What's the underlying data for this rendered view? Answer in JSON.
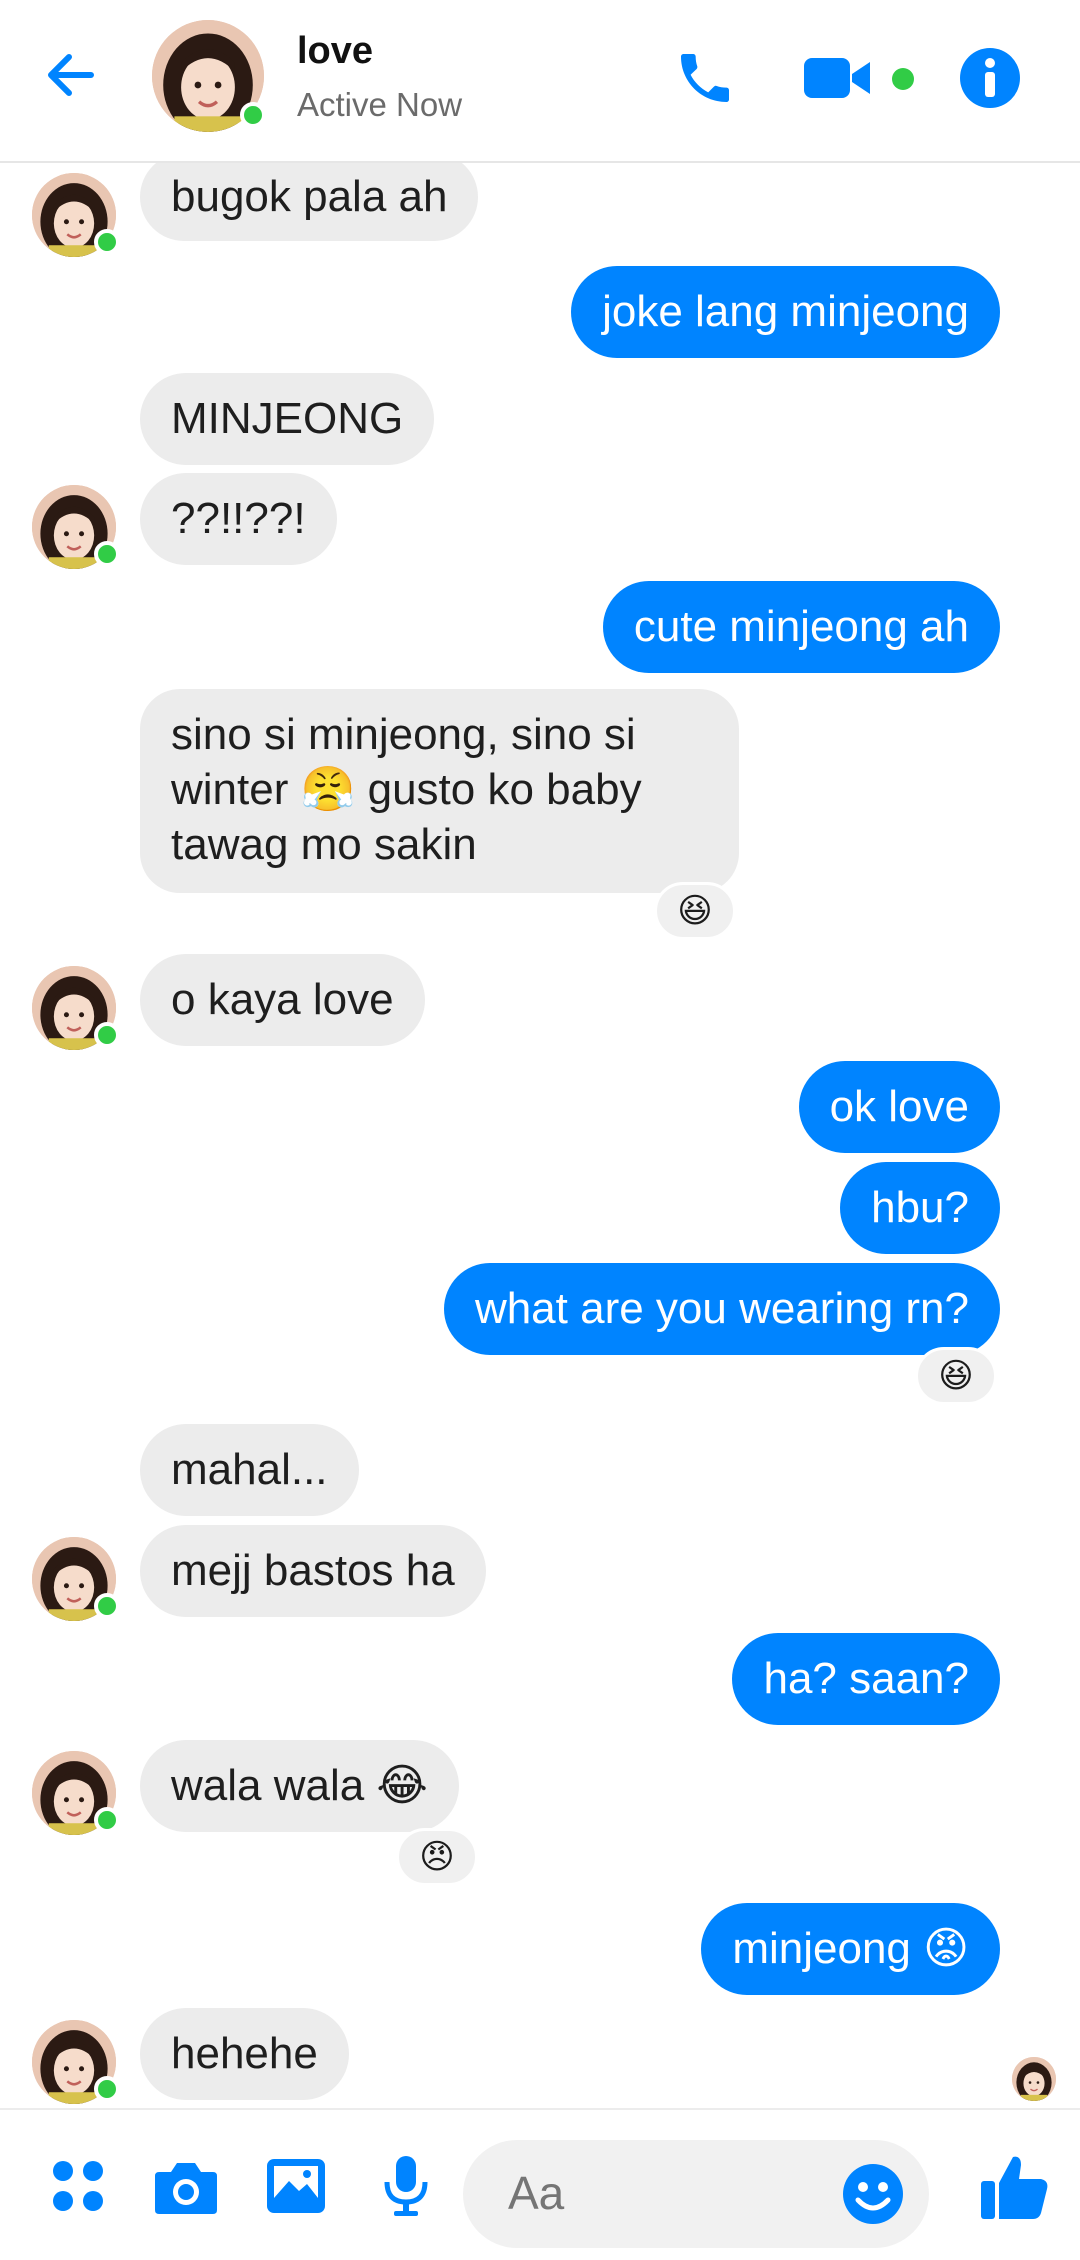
{
  "header": {
    "name": "love",
    "status": "Active Now",
    "accent_color": "#0084ff",
    "online_color": "#31cc46"
  },
  "messages": [
    {
      "from": "them",
      "text": "bugok pala ah"
    },
    {
      "from": "me",
      "text": "joke lang minjeong"
    },
    {
      "from": "them",
      "text": "MINJEONG"
    },
    {
      "from": "them",
      "text": "??!!??!"
    },
    {
      "from": "me",
      "text": "cute minjeong ah"
    },
    {
      "from": "them",
      "text": "sino si minjeong, sino si winter 😤 gusto ko baby tawag mo sakin",
      "reaction": "😆"
    },
    {
      "from": "them",
      "text": "o kaya love"
    },
    {
      "from": "me",
      "text": "ok love"
    },
    {
      "from": "me",
      "text": "hbu?"
    },
    {
      "from": "me",
      "text": "what are you wearing rn?",
      "reaction": "😆"
    },
    {
      "from": "them",
      "text": "mahal..."
    },
    {
      "from": "them",
      "text": "mejj bastos ha"
    },
    {
      "from": "me",
      "text": "ha? saan?"
    },
    {
      "from": "them",
      "text": "wala wala 😂",
      "reaction": "😠"
    },
    {
      "from": "me",
      "text": "minjeong 😡"
    },
    {
      "from": "them",
      "text": "hehehe"
    }
  ],
  "composer": {
    "placeholder": "Aa",
    "icons": [
      "menu-icon",
      "camera-icon",
      "gallery-icon",
      "microphone-icon",
      "emoji-icon",
      "thumbs-up-icon"
    ]
  }
}
